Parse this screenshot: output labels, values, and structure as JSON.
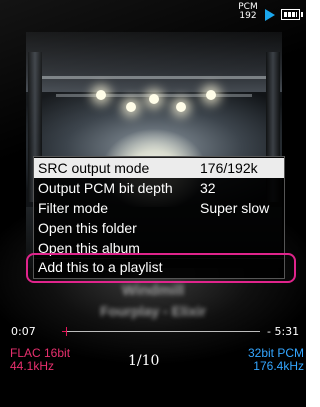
{
  "status_bar": {
    "format_line1": "PCM",
    "format_line2": "192",
    "play_icon": "play-icon",
    "battery_icon": "battery-icon"
  },
  "context_menu": {
    "items": [
      {
        "label": "SRC output mode",
        "value": "176/192k",
        "selected": true
      },
      {
        "label": "Output PCM bit depth",
        "value": "32",
        "selected": false
      },
      {
        "label": "Filter mode",
        "value": "Super slow",
        "selected": false
      },
      {
        "label": "Open this folder",
        "value": "",
        "selected": false
      },
      {
        "label": "Open this album",
        "value": "",
        "selected": false
      }
    ],
    "add_to_playlist_label": "Add this to a playlist"
  },
  "track": {
    "title": "Windmill",
    "artist": "Fourplay - Elixir"
  },
  "playback": {
    "elapsed": "0:07",
    "remaining": "- 5:31",
    "progress": 0.02
  },
  "footer": {
    "source_format_line1": "FLAC 16bit",
    "source_format_line2": "44.1kHz",
    "track_counter": "1/10",
    "output_format_line1": "32bit PCM",
    "output_format_line2": "176.4kHz"
  },
  "colors": {
    "highlight_ring": "#e0248c",
    "seek_accent": "#e4185a",
    "source_format": "#e8306e",
    "output_format": "#34a6ff",
    "play_icon": "#1aa7ee"
  }
}
